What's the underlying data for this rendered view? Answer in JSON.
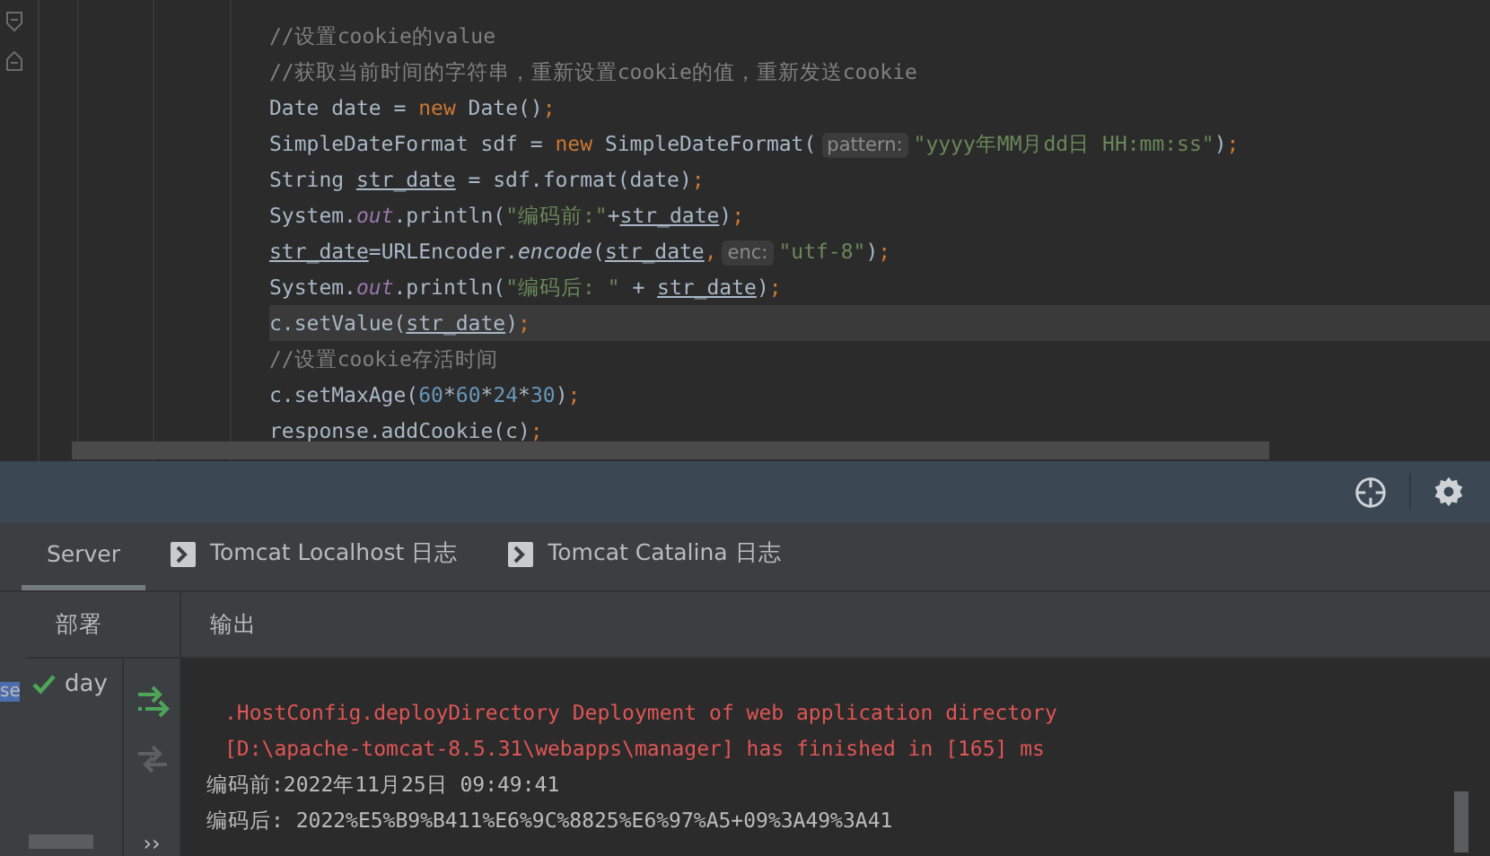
{
  "editor": {
    "lines": [
      {
        "current": false,
        "tokens": [
          {
            "t": "//设置cookie的value",
            "kind": "cm"
          }
        ]
      },
      {
        "current": false,
        "tokens": [
          {
            "t": "//获取当前时间的字符串，重新设置cookie的值，重新发送cookie",
            "kind": "cm"
          }
        ]
      },
      {
        "current": false,
        "tokens": [
          {
            "t": "Date date = ",
            "kind": "pl"
          },
          {
            "t": "new",
            "kind": "kw"
          },
          {
            "t": " Date()",
            "kind": "pl"
          },
          {
            "t": ";",
            "kind": "kw"
          }
        ]
      },
      {
        "current": false,
        "tokens": [
          {
            "t": "SimpleDateFormat sdf = ",
            "kind": "pl"
          },
          {
            "t": "new",
            "kind": "kw"
          },
          {
            "t": " SimpleDateFormat(",
            "kind": "pl"
          },
          {
            "t": "pattern:",
            "kind": "hint"
          },
          {
            "t": "\"yyyy年MM月dd日 HH:mm:ss\"",
            "kind": "str"
          },
          {
            "t": ")",
            "kind": "pl"
          },
          {
            "t": ";",
            "kind": "kw"
          }
        ]
      },
      {
        "current": false,
        "tokens": [
          {
            "t": "String ",
            "kind": "pl"
          },
          {
            "t": "str_date",
            "kind": "var"
          },
          {
            "t": " = sdf.format(date)",
            "kind": "pl"
          },
          {
            "t": ";",
            "kind": "kw"
          }
        ]
      },
      {
        "current": false,
        "tokens": [
          {
            "t": "System.",
            "kind": "pl"
          },
          {
            "t": "out",
            "kind": "fld"
          },
          {
            "t": ".println(",
            "kind": "pl"
          },
          {
            "t": "\"编码前:\"",
            "kind": "str"
          },
          {
            "t": "+",
            "kind": "pl"
          },
          {
            "t": "str_date",
            "kind": "var"
          },
          {
            "t": ")",
            "kind": "pl"
          },
          {
            "t": ";",
            "kind": "kw"
          }
        ]
      },
      {
        "current": false,
        "tokens": [
          {
            "t": "str_date",
            "kind": "var"
          },
          {
            "t": "=URLEncoder.",
            "kind": "pl"
          },
          {
            "t": "encode",
            "kind": "it"
          },
          {
            "t": "(",
            "kind": "pl"
          },
          {
            "t": "str_date",
            "kind": "var"
          },
          {
            "t": ",",
            "kind": "kw"
          },
          {
            "t": "enc:",
            "kind": "hint"
          },
          {
            "t": "\"utf-8\"",
            "kind": "str"
          },
          {
            "t": ")",
            "kind": "pl"
          },
          {
            "t": ";",
            "kind": "kw"
          }
        ]
      },
      {
        "current": false,
        "tokens": [
          {
            "t": "System.",
            "kind": "pl"
          },
          {
            "t": "out",
            "kind": "fld"
          },
          {
            "t": ".println(",
            "kind": "pl"
          },
          {
            "t": "\"编码后: \"",
            "kind": "str"
          },
          {
            "t": " + ",
            "kind": "pl"
          },
          {
            "t": "str_date",
            "kind": "var"
          },
          {
            "t": ")",
            "kind": "pl"
          },
          {
            "t": ";",
            "kind": "kw"
          }
        ]
      },
      {
        "current": true,
        "tokens": [
          {
            "t": "c.setValue(",
            "kind": "pl"
          },
          {
            "t": "str_date",
            "kind": "var"
          },
          {
            "t": ")",
            "kind": "pl"
          },
          {
            "t": ";",
            "kind": "kw"
          }
        ]
      },
      {
        "current": false,
        "tokens": [
          {
            "t": "//设置cookie存活时间",
            "kind": "cm"
          }
        ]
      },
      {
        "current": false,
        "tokens": [
          {
            "t": "c.setMaxAge(",
            "kind": "pl"
          },
          {
            "t": "60",
            "kind": "num"
          },
          {
            "t": "*",
            "kind": "pl"
          },
          {
            "t": "60",
            "kind": "num"
          },
          {
            "t": "*",
            "kind": "pl"
          },
          {
            "t": "24",
            "kind": "num"
          },
          {
            "t": "*",
            "kind": "pl"
          },
          {
            "t": "30",
            "kind": "num"
          },
          {
            "t": ")",
            "kind": "pl"
          },
          {
            "t": ";",
            "kind": "kw"
          }
        ]
      },
      {
        "current": false,
        "tokens": [
          {
            "t": "response.addCookie(c)",
            "kind": "pl"
          },
          {
            "t": ";",
            "kind": "kw"
          }
        ]
      }
    ]
  },
  "tabs": [
    {
      "label": "Server",
      "selected": true,
      "kind": "plain"
    },
    {
      "label": "Tomcat Localhost 日志",
      "selected": false,
      "kind": "console"
    },
    {
      "label": "Tomcat Catalina 日志",
      "selected": false,
      "kind": "console"
    }
  ],
  "side_strip": {
    "label": "se"
  },
  "deploy": {
    "header": "部署",
    "items": [
      {
        "label": "day",
        "ok": true
      }
    ],
    "more": "››"
  },
  "output": {
    "header": "输出",
    "lines": [
      {
        "text": ".HostConfig.deployDirectory Deployment of web application directory",
        "kind": "error"
      },
      {
        "text": "[D:\\apache-tomcat-8.5.31\\webapps\\manager] has finished in [165] ms",
        "kind": "error"
      },
      {
        "text": "编码前:2022年11月25日 09:49:41",
        "kind": "normal"
      },
      {
        "text": "编码后: 2022%E5%B9%B411%E6%9C%8825%E6%97%A5+09%3A49%3A41",
        "kind": "normal"
      }
    ]
  }
}
